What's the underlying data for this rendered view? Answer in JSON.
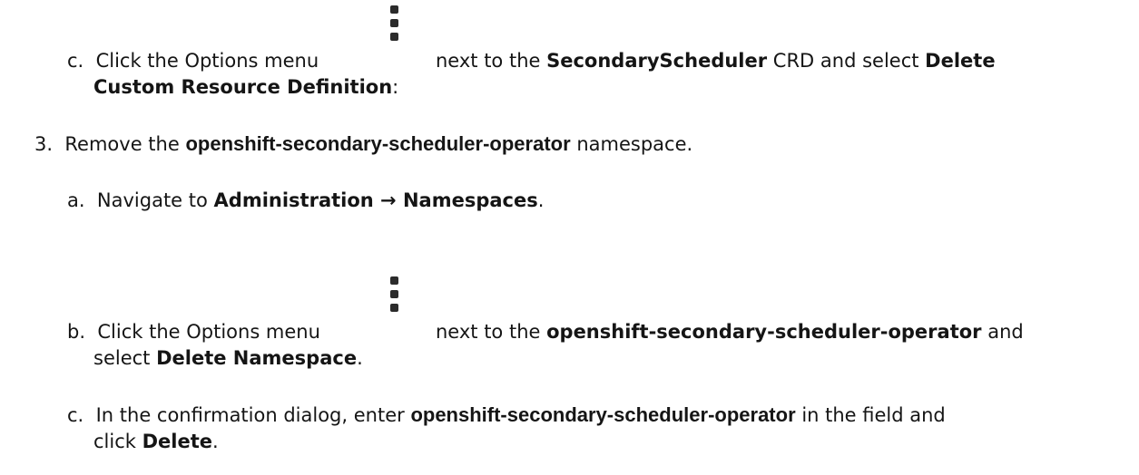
{
  "steps": {
    "step_c1": {
      "marker": "c.",
      "pre": "Click the Options menu",
      "mid": "next to the",
      "bold_name": "SecondaryScheduler",
      "post": "CRD and select",
      "bold_action_1": "Delete",
      "bold_action_2": "Custom Resource Definition",
      "tail": ":",
      "icon": "kebab-icon"
    },
    "step_3": {
      "marker": "3.",
      "pre": "Remove the",
      "bold_name": "openshift-secondary-scheduler-operator",
      "post": "namespace."
    },
    "step_a": {
      "marker": "a.",
      "pre": "Navigate to",
      "bold_path": "Administration → Namespaces",
      "tail": "."
    },
    "step_b": {
      "marker": "b.",
      "pre": "Click the Options menu",
      "mid": "next to the",
      "bold_name": "openshift-secondary-scheduler-operator",
      "post": "and",
      "pre2": "select",
      "bold_action": "Delete Namespace",
      "tail": ".",
      "icon": "kebab-icon"
    },
    "step_c2": {
      "marker": "c.",
      "pre": "In the confirmation dialog, enter",
      "bold_name": "openshift-secondary-scheduler-operator",
      "post": "in the field and",
      "pre2": "click",
      "bold_action": "Delete",
      "tail": "."
    }
  }
}
